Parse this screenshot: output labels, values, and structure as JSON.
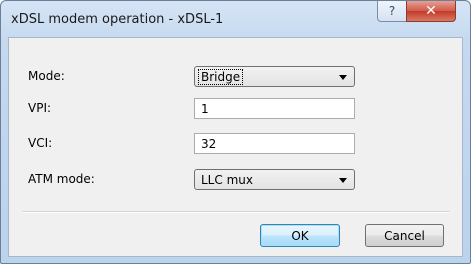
{
  "window": {
    "title": "xDSL modem operation - xDSL-1",
    "help_glyph": "?",
    "close_glyph": "✕"
  },
  "form": {
    "mode": {
      "label": "Mode:",
      "value": "Bridge"
    },
    "vpi": {
      "label": "VPI:",
      "value": "1"
    },
    "vci": {
      "label": "VCI:",
      "value": "32"
    },
    "atm_mode": {
      "label": "ATM mode:",
      "value": "LLC mux"
    }
  },
  "buttons": {
    "ok": "OK",
    "cancel": "Cancel"
  }
}
